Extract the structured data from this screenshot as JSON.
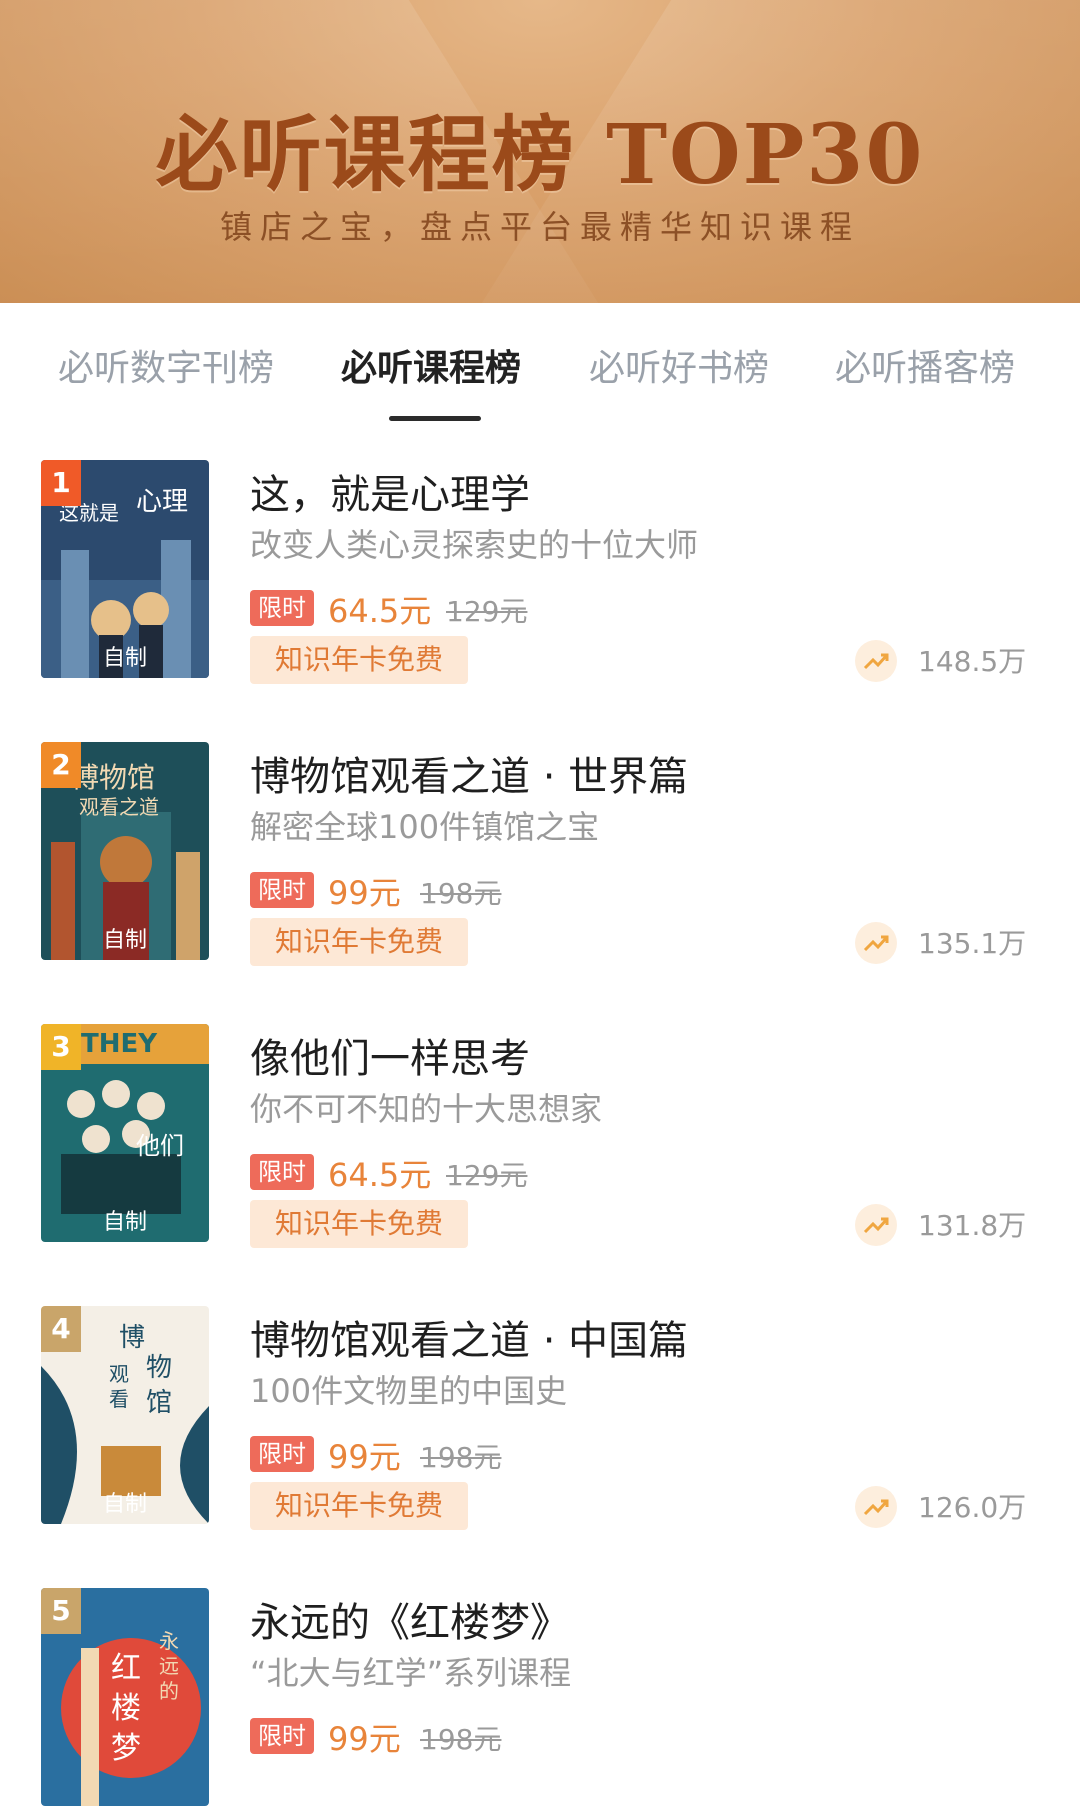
{
  "banner": {
    "title": "必听课程榜 TOP30",
    "subtitle": "镇店之宝，盘点平台最精华知识课程"
  },
  "tabs": [
    {
      "label": "必听数字刊榜",
      "active": false
    },
    {
      "label": "必听课程榜",
      "active": true
    },
    {
      "label": "必听好书榜",
      "active": false
    },
    {
      "label": "必听播客榜",
      "active": false
    }
  ],
  "items": [
    {
      "rank": "1",
      "cover_tag": "自制",
      "title": "这，就是心理学",
      "subtitle": "改变人类心灵探索史的十位大师",
      "badge": "限时",
      "price": "64.5元",
      "original_price": "129元",
      "free_label": "知识年卡免费",
      "count": "148.5万",
      "rank_color": "#f05a28",
      "cover_color": "#2c4a6e"
    },
    {
      "rank": "2",
      "cover_tag": "自制",
      "title": "博物馆观看之道 · 世界篇",
      "subtitle": "解密全球100件镇馆之宝",
      "badge": "限时",
      "price": "99元",
      "original_price": "198元",
      "free_label": "知识年卡免费",
      "count": "135.1万",
      "rank_color": "#f08a28",
      "cover_color": "#1e4f59"
    },
    {
      "rank": "3",
      "cover_tag": "自制",
      "title": "像他们一样思考",
      "subtitle": "你不可不知的十大思想家",
      "badge": "限时",
      "price": "64.5元",
      "original_price": "129元",
      "free_label": "知识年卡免费",
      "count": "131.8万",
      "rank_color": "#f0b428",
      "cover_color": "#1f6c70"
    },
    {
      "rank": "4",
      "cover_tag": "自制",
      "title": "博物馆观看之道 · 中国篇",
      "subtitle": "100件文物里的中国史",
      "badge": "限时",
      "price": "99元",
      "original_price": "198元",
      "free_label": "知识年卡免费",
      "count": "126.0万",
      "rank_color": "#c9a56a",
      "cover_color": "#1f4f66"
    },
    {
      "rank": "5",
      "cover_tag": "",
      "title": "永远的《红楼梦》",
      "subtitle": "“北大与红学”系列课程",
      "badge": "限时",
      "price": "99元",
      "original_price": "198元",
      "free_label": "",
      "count": "",
      "rank_color": "#c9a56a",
      "cover_color": "#e04a3a"
    }
  ]
}
